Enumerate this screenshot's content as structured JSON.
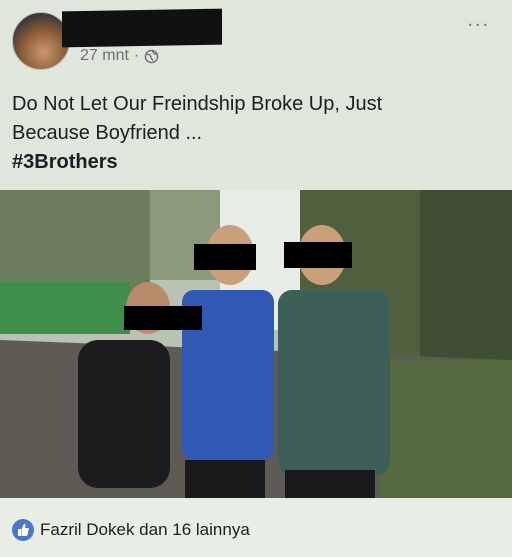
{
  "post": {
    "time": "27 mnt",
    "separator": "·",
    "text_line1": "Do Not Let Our Freindship Broke Up, Just",
    "text_line2": "Because Boyfriend ...",
    "hashtag": "#3Brothers",
    "more_label": "..."
  },
  "reactions": {
    "summary": "Fazril Dokek dan 16 lainnya"
  },
  "icons": {
    "privacy": "globe-icon",
    "reaction": "like-icon",
    "menu": "more-icon"
  },
  "colors": {
    "like_blue": "#4a78c8",
    "background": "#dfe6dc"
  }
}
